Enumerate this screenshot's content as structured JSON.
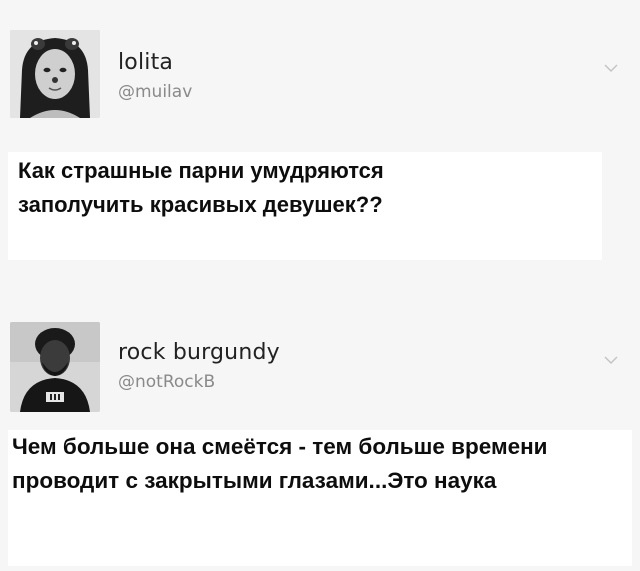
{
  "tweets": [
    {
      "display_name": "lolita",
      "handle": "@muilav",
      "text": "Как страшные парни умудряются\nзаполучить красивых девушек??",
      "avatar_icon": "avatar-photo-girl",
      "menu_icon": "chevron-down-icon"
    },
    {
      "display_name": "rock burgundy",
      "handle": "@notRockB",
      "text": "Чем больше она смеётся - тем больше времени\nпроводит с закрытыми глазами...Это наука",
      "avatar_icon": "avatar-photo-man",
      "menu_icon": "chevron-down-icon"
    }
  ],
  "colors": {
    "background": "#f6f6f6",
    "text_box": "#ffffff",
    "name": "#222222",
    "handle": "#8a8a8a",
    "body_text": "#0d0d0d"
  }
}
